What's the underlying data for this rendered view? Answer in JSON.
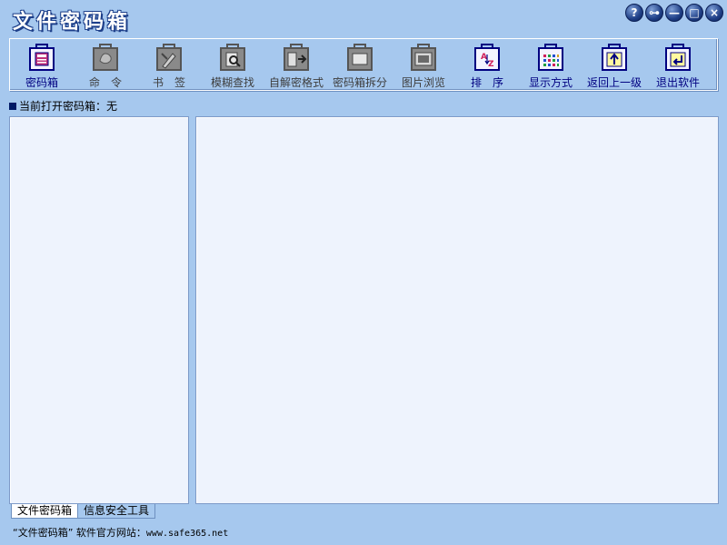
{
  "app": {
    "title": "文件密码箱"
  },
  "window_controls": [
    {
      "name": "help-button",
      "icon": "help-icon",
      "glyph": "?"
    },
    {
      "name": "key-button",
      "icon": "key-icon",
      "glyph": "⊶"
    },
    {
      "name": "minimize-button",
      "icon": "minimize-icon",
      "glyph": "—"
    },
    {
      "name": "maximize-button",
      "icon": "maximize-icon",
      "glyph": "□"
    },
    {
      "name": "close-button",
      "icon": "close-icon",
      "glyph": "×"
    }
  ],
  "toolbar": {
    "items": [
      {
        "label": "密码箱",
        "icon": "safe-icon",
        "enabled": true
      },
      {
        "label": "命　令",
        "icon": "hand-icon",
        "enabled": false
      },
      {
        "label": "书　签",
        "icon": "bookmark-icon",
        "enabled": false
      },
      {
        "label": "模糊查找",
        "icon": "search-icon",
        "enabled": false
      },
      {
        "label": "自解密格式",
        "icon": "self-decrypt-icon",
        "enabled": false
      },
      {
        "label": "密码箱拆分",
        "icon": "split-icon",
        "enabled": false
      },
      {
        "label": "图片浏览",
        "icon": "image-icon",
        "enabled": false
      },
      {
        "label": "排　序",
        "icon": "sort-icon",
        "enabled": true
      },
      {
        "label": "显示方式",
        "icon": "view-mode-icon",
        "enabled": true
      },
      {
        "label": "返回上一级",
        "icon": "up-level-icon",
        "enabled": true
      },
      {
        "label": "退出软件",
        "icon": "exit-icon",
        "enabled": true
      }
    ]
  },
  "status": {
    "text": "当前打开密码箱：无"
  },
  "tabs": [
    {
      "label": "文件密码箱",
      "active": true
    },
    {
      "label": "信息安全工具",
      "active": false
    }
  ],
  "footer": {
    "text": "“文件密码箱” 软件官方网站：",
    "url": "www.safe365.net"
  },
  "colors": {
    "background": "#a6c8ee",
    "panel": "#eef3fd",
    "enabled_icon": "#000080",
    "disabled_icon": "#8a8a8a",
    "title_outline": "#1d3f8a"
  }
}
